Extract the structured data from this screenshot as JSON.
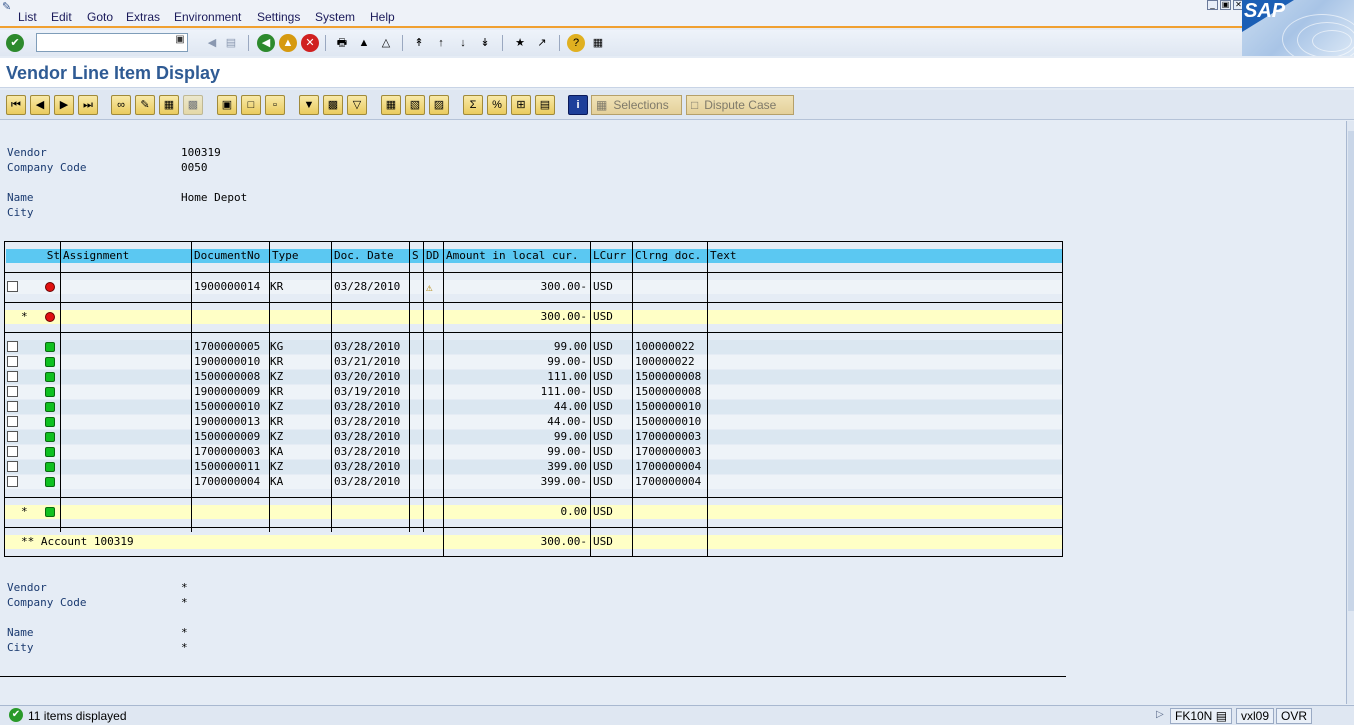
{
  "menu": [
    "List",
    "Edit",
    "Goto",
    "Extras",
    "Environment",
    "Settings",
    "System",
    "Help"
  ],
  "brand": "SAP",
  "command_field": {
    "value": ""
  },
  "title": "Vendor Line Item Display",
  "app_toolbar": {
    "selections_label": "Selections",
    "dispute_label": "Dispute Case"
  },
  "header": {
    "vendor_label": "Vendor",
    "vendor_value": "100319",
    "company_label": "Company Code",
    "company_value": "0050",
    "name_label": "Name",
    "name_value": "Home Depot",
    "city_label": "City",
    "city_value": ""
  },
  "table": {
    "columns": [
      "St",
      "Assignment",
      "DocumentNo",
      "Type",
      "Doc. Date",
      "S",
      "DD",
      "Amount in local cur.",
      "LCurr",
      "Clrng doc.",
      "Text"
    ],
    "open_items": [
      {
        "status": "red",
        "assignment": "",
        "doc_no": "1900000014",
        "type": "KR",
        "doc_date": "03/28/2010",
        "dd": "warning",
        "amount": "300.00-",
        "currency": "USD",
        "clearing_doc": "",
        "text": ""
      }
    ],
    "open_subtotal": {
      "marker": "*",
      "status": "red",
      "amount": "300.00-",
      "currency": "USD"
    },
    "cleared_items": [
      {
        "status": "green",
        "doc_no": "1700000005",
        "type": "KG",
        "doc_date": "03/28/2010",
        "amount": "99.00",
        "currency": "USD",
        "clearing_doc": "100000022"
      },
      {
        "status": "green",
        "doc_no": "1900000010",
        "type": "KR",
        "doc_date": "03/21/2010",
        "amount": "99.00-",
        "currency": "USD",
        "clearing_doc": "100000022"
      },
      {
        "status": "green",
        "doc_no": "1500000008",
        "type": "KZ",
        "doc_date": "03/20/2010",
        "amount": "111.00",
        "currency": "USD",
        "clearing_doc": "1500000008"
      },
      {
        "status": "green",
        "doc_no": "1900000009",
        "type": "KR",
        "doc_date": "03/19/2010",
        "amount": "111.00-",
        "currency": "USD",
        "clearing_doc": "1500000008"
      },
      {
        "status": "green",
        "doc_no": "1500000010",
        "type": "KZ",
        "doc_date": "03/28/2010",
        "amount": "44.00",
        "currency": "USD",
        "clearing_doc": "1500000010"
      },
      {
        "status": "green",
        "doc_no": "1900000013",
        "type": "KR",
        "doc_date": "03/28/2010",
        "amount": "44.00-",
        "currency": "USD",
        "clearing_doc": "1500000010"
      },
      {
        "status": "green",
        "doc_no": "1500000009",
        "type": "KZ",
        "doc_date": "03/28/2010",
        "amount": "99.00",
        "currency": "USD",
        "clearing_doc": "1700000003"
      },
      {
        "status": "green",
        "doc_no": "1700000003",
        "type": "KA",
        "doc_date": "03/28/2010",
        "amount": "99.00-",
        "currency": "USD",
        "clearing_doc": "1700000003"
      },
      {
        "status": "green",
        "doc_no": "1500000011",
        "type": "KZ",
        "doc_date": "03/28/2010",
        "amount": "399.00",
        "currency": "USD",
        "clearing_doc": "1700000004"
      },
      {
        "status": "green",
        "doc_no": "1700000004",
        "type": "KA",
        "doc_date": "03/28/2010",
        "amount": "399.00-",
        "currency": "USD",
        "clearing_doc": "1700000004"
      }
    ],
    "cleared_subtotal": {
      "marker": "*",
      "status": "green",
      "amount": "0.00",
      "currency": "USD"
    },
    "account_total": {
      "label": "** Account 100319",
      "amount": "300.00-",
      "currency": "USD"
    }
  },
  "footer_header": {
    "vendor_label": "Vendor",
    "vendor_value": "*",
    "company_label": "Company Code",
    "company_value": "*",
    "name_label": "Name",
    "name_value": "*",
    "city_label": "City",
    "city_value": "*"
  },
  "status_bar": {
    "message": "11 items displayed",
    "transaction": "FK10N",
    "server": "vxl09",
    "mode": "OVR"
  },
  "colors": {
    "header_cyan": "#5bc8f2",
    "row_light": "#dbe7f1",
    "row_white": "#eef3f8",
    "subtotal_yellow": "#ffffc6",
    "title_blue": "#2f5b94"
  }
}
